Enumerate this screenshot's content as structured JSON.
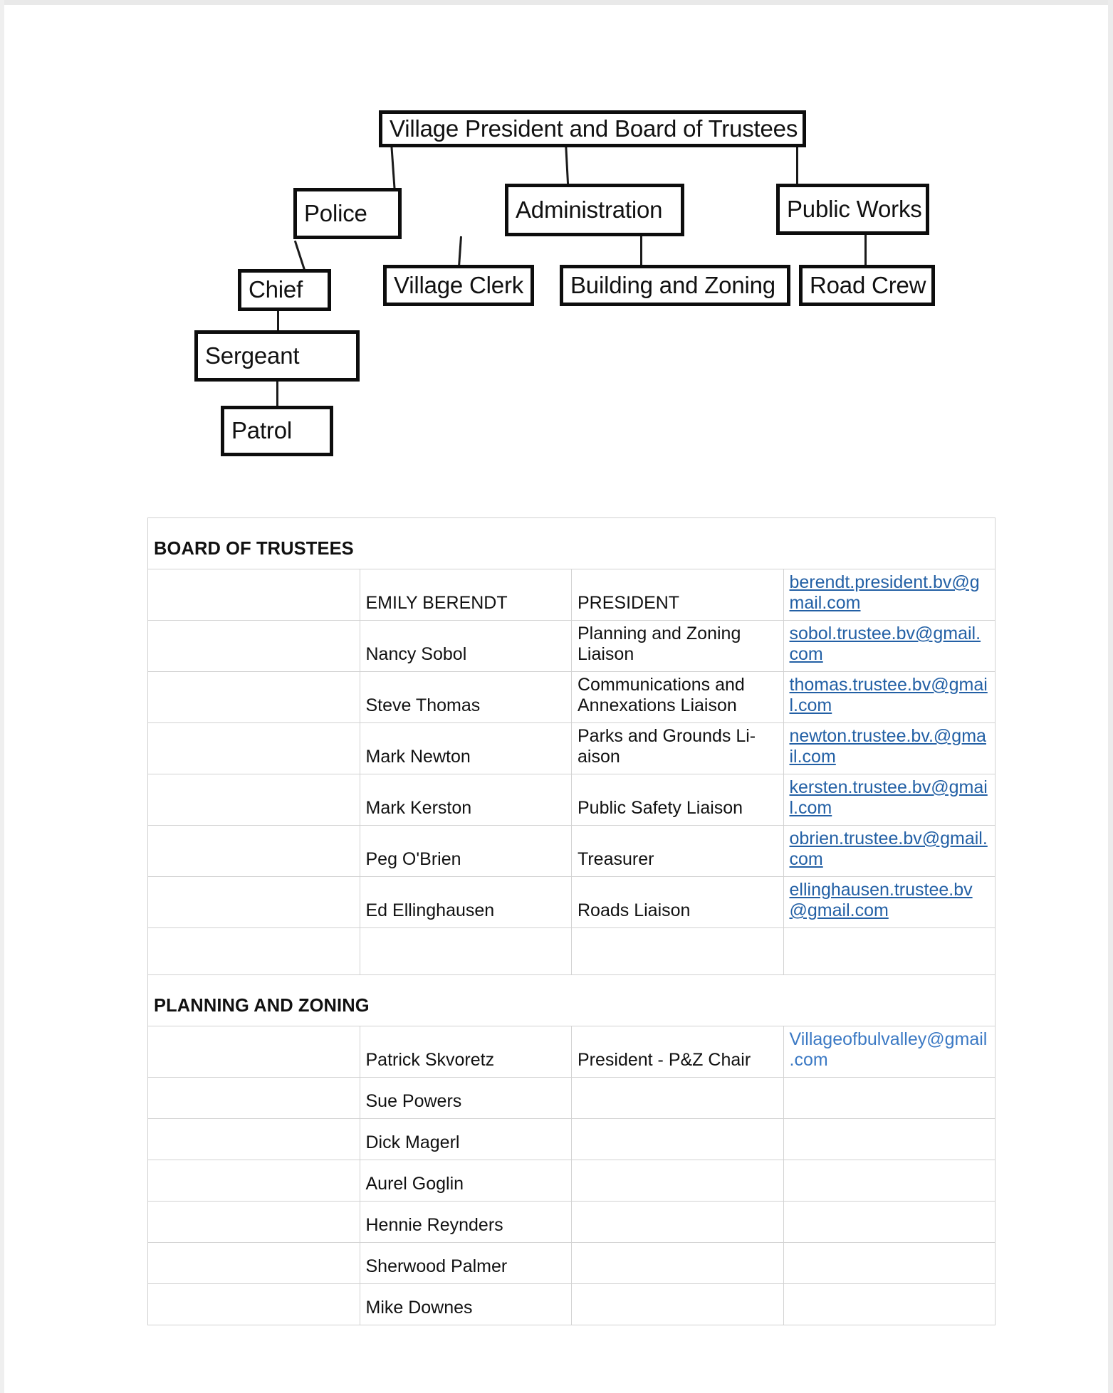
{
  "org_chart": {
    "title": "Village of Bull Valley organizational chart",
    "nodes": [
      {
        "id": "root",
        "label": "Village President and Board of Trustees"
      },
      {
        "id": "police",
        "label": "Police"
      },
      {
        "id": "admin",
        "label": "Administration"
      },
      {
        "id": "pubworks",
        "label": "Public Works"
      },
      {
        "id": "chief",
        "label": "Chief"
      },
      {
        "id": "clerk",
        "label": "Village Clerk"
      },
      {
        "id": "bldgzone",
        "label": "Building and Zoning"
      },
      {
        "id": "roadcrew",
        "label": "Road Crew"
      },
      {
        "id": "sergeant",
        "label": "Sergeant"
      },
      {
        "id": "patrol",
        "label": "Patrol"
      }
    ],
    "edges": [
      {
        "from": "root",
        "to": "police"
      },
      {
        "from": "root",
        "to": "admin"
      },
      {
        "from": "root",
        "to": "pubworks"
      },
      {
        "from": "police",
        "to": "chief"
      },
      {
        "from": "admin",
        "to": "clerk"
      },
      {
        "from": "admin",
        "to": "bldgzone"
      },
      {
        "from": "pubworks",
        "to": "roadcrew"
      },
      {
        "from": "chief",
        "to": "sergeant"
      },
      {
        "from": "sergeant",
        "to": "patrol"
      }
    ]
  },
  "roster": {
    "sections": [
      {
        "heading": "BOARD OF TRUSTEES",
        "rows": [
          {
            "name": "EMILY BERENDT",
            "role": "PRESIDENT",
            "email": "berendt.president.bv@gmail.com",
            "email_style": "underlined"
          },
          {
            "name": "Nancy Sobol",
            "role": "Planning and Zoning Liaison",
            "email": "sobol.trustee.bv@gmail.com",
            "email_style": "underlined"
          },
          {
            "name": "Steve Thomas",
            "role": "Communications and Annexations Liaison",
            "email": "thomas.trustee.bv@gmail.com",
            "email_style": "underlined"
          },
          {
            "name": "Mark Newton",
            "role": "Parks and Grounds Li-aison",
            "email": "newton.trustee.bv.@gmail.com",
            "email_style": "underlined"
          },
          {
            "name": "Mark Kerston",
            "role": "Public Safety Liaison",
            "email": "kersten.trustee.bv@gmail.com",
            "email_style": "underlined"
          },
          {
            "name": "Peg O'Brien",
            "role": "Treasurer",
            "email": "obrien.trustee.bv@gmail.com",
            "email_style": "underlined"
          },
          {
            "name": "Ed Ellinghausen",
            "role": "Roads Liaison",
            "email": "ellinghausen.trustee.bv@gmail.com",
            "email_style": "underlined"
          },
          {
            "name": "",
            "role": "",
            "email": "",
            "email_style": "none"
          }
        ]
      },
      {
        "heading": "PLANNING AND ZONING",
        "rows": [
          {
            "name": "Patrick Skvoretz",
            "role": "President - P&Z Chair",
            "email": "Villageofbulvalley@gmail.com",
            "email_style": "plain"
          },
          {
            "name": "Sue Powers",
            "role": "",
            "email": "",
            "email_style": "none"
          },
          {
            "name": "Dick Magerl",
            "role": "",
            "email": "",
            "email_style": "none"
          },
          {
            "name": "Aurel Goglin",
            "role": "",
            "email": "",
            "email_style": "none"
          },
          {
            "name": "Hennie Reynders",
            "role": "",
            "email": "",
            "email_style": "none"
          },
          {
            "name": "Sherwood Palmer",
            "role": "",
            "email": "",
            "email_style": "none"
          },
          {
            "name": "Mike Downes",
            "role": "",
            "email": "",
            "email_style": "none"
          }
        ]
      }
    ]
  },
  "colors": {
    "box_border": "#0d0d0d",
    "link": "#2360a5",
    "link_plain": "#3b79c4",
    "table_border": "#d2d2d2",
    "text": "#111111",
    "page_background": "#ffffff"
  }
}
